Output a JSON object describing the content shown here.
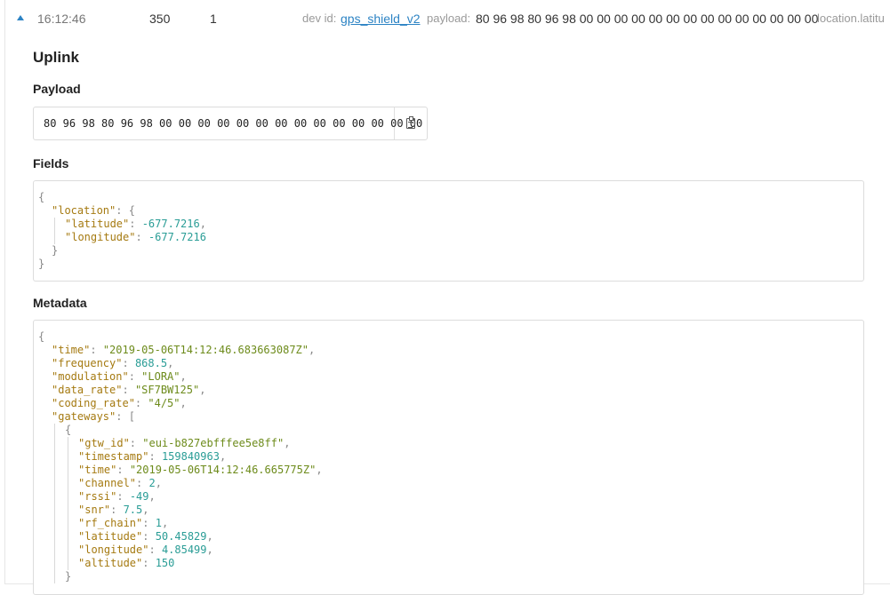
{
  "row": {
    "time": "16:12:46",
    "counter": "350",
    "port": "1",
    "dev_id_label": "dev id:",
    "dev_id": "gps_shield_v2",
    "payload_label": "payload:",
    "payload": "80 96 98 80 96 98 00 00 00 00 00 00 00 00 00 00 00 00 00 00",
    "fields_preview": "location.latitu"
  },
  "uplink": {
    "title": "Uplink",
    "payload_heading": "Payload",
    "payload_hex": "80 96 98 80 96 98 00 00 00 00 00 00 00 00 00 00 00 00 00 00",
    "fields_heading": "Fields",
    "metadata_heading": "Metadata"
  },
  "fields_lines": [
    {
      "indent": 0,
      "parts": [
        {
          "c": "p",
          "t": "{"
        }
      ]
    },
    {
      "indent": 1,
      "parts": [
        {
          "c": "k",
          "t": "\"location\""
        },
        {
          "c": "p",
          "t": ": {"
        }
      ]
    },
    {
      "indent": 2,
      "parts": [
        {
          "c": "k",
          "t": "\"latitude\""
        },
        {
          "c": "p",
          "t": ": "
        },
        {
          "c": "n",
          "t": "-677.7216"
        },
        {
          "c": "p",
          "t": ","
        }
      ]
    },
    {
      "indent": 2,
      "parts": [
        {
          "c": "k",
          "t": "\"longitude\""
        },
        {
          "c": "p",
          "t": ": "
        },
        {
          "c": "n",
          "t": "-677.7216"
        }
      ]
    },
    {
      "indent": 1,
      "parts": [
        {
          "c": "p",
          "t": "}"
        }
      ]
    },
    {
      "indent": 0,
      "parts": [
        {
          "c": "p",
          "t": "}"
        }
      ]
    }
  ],
  "metadata_lines": [
    {
      "indent": 0,
      "parts": [
        {
          "c": "p",
          "t": "{"
        }
      ]
    },
    {
      "indent": 1,
      "parts": [
        {
          "c": "k",
          "t": "\"time\""
        },
        {
          "c": "p",
          "t": ": "
        },
        {
          "c": "s",
          "t": "\"2019-05-06T14:12:46.683663087Z\""
        },
        {
          "c": "p",
          "t": ","
        }
      ]
    },
    {
      "indent": 1,
      "parts": [
        {
          "c": "k",
          "t": "\"frequency\""
        },
        {
          "c": "p",
          "t": ": "
        },
        {
          "c": "n",
          "t": "868.5"
        },
        {
          "c": "p",
          "t": ","
        }
      ]
    },
    {
      "indent": 1,
      "parts": [
        {
          "c": "k",
          "t": "\"modulation\""
        },
        {
          "c": "p",
          "t": ": "
        },
        {
          "c": "s",
          "t": "\"LORA\""
        },
        {
          "c": "p",
          "t": ","
        }
      ]
    },
    {
      "indent": 1,
      "parts": [
        {
          "c": "k",
          "t": "\"data_rate\""
        },
        {
          "c": "p",
          "t": ": "
        },
        {
          "c": "s",
          "t": "\"SF7BW125\""
        },
        {
          "c": "p",
          "t": ","
        }
      ]
    },
    {
      "indent": 1,
      "parts": [
        {
          "c": "k",
          "t": "\"coding_rate\""
        },
        {
          "c": "p",
          "t": ": "
        },
        {
          "c": "s",
          "t": "\"4/5\""
        },
        {
          "c": "p",
          "t": ","
        }
      ]
    },
    {
      "indent": 1,
      "parts": [
        {
          "c": "k",
          "t": "\"gateways\""
        },
        {
          "c": "p",
          "t": ": ["
        }
      ]
    },
    {
      "indent": 2,
      "parts": [
        {
          "c": "p",
          "t": "{"
        }
      ]
    },
    {
      "indent": 3,
      "parts": [
        {
          "c": "k",
          "t": "\"gtw_id\""
        },
        {
          "c": "p",
          "t": ": "
        },
        {
          "c": "s",
          "t": "\"eui-b827ebfffee5e8ff\""
        },
        {
          "c": "p",
          "t": ","
        }
      ]
    },
    {
      "indent": 3,
      "parts": [
        {
          "c": "k",
          "t": "\"timestamp\""
        },
        {
          "c": "p",
          "t": ": "
        },
        {
          "c": "n",
          "t": "159840963"
        },
        {
          "c": "p",
          "t": ","
        }
      ]
    },
    {
      "indent": 3,
      "parts": [
        {
          "c": "k",
          "t": "\"time\""
        },
        {
          "c": "p",
          "t": ": "
        },
        {
          "c": "s",
          "t": "\"2019-05-06T14:12:46.665775Z\""
        },
        {
          "c": "p",
          "t": ","
        }
      ]
    },
    {
      "indent": 3,
      "parts": [
        {
          "c": "k",
          "t": "\"channel\""
        },
        {
          "c": "p",
          "t": ": "
        },
        {
          "c": "n",
          "t": "2"
        },
        {
          "c": "p",
          "t": ","
        }
      ]
    },
    {
      "indent": 3,
      "parts": [
        {
          "c": "k",
          "t": "\"rssi\""
        },
        {
          "c": "p",
          "t": ": "
        },
        {
          "c": "n",
          "t": "-49"
        },
        {
          "c": "p",
          "t": ","
        }
      ]
    },
    {
      "indent": 3,
      "parts": [
        {
          "c": "k",
          "t": "\"snr\""
        },
        {
          "c": "p",
          "t": ": "
        },
        {
          "c": "n",
          "t": "7.5"
        },
        {
          "c": "p",
          "t": ","
        }
      ]
    },
    {
      "indent": 3,
      "parts": [
        {
          "c": "k",
          "t": "\"rf_chain\""
        },
        {
          "c": "p",
          "t": ": "
        },
        {
          "c": "n",
          "t": "1"
        },
        {
          "c": "p",
          "t": ","
        }
      ]
    },
    {
      "indent": 3,
      "parts": [
        {
          "c": "k",
          "t": "\"latitude\""
        },
        {
          "c": "p",
          "t": ": "
        },
        {
          "c": "n",
          "t": "50.45829"
        },
        {
          "c": "p",
          "t": ","
        }
      ]
    },
    {
      "indent": 3,
      "parts": [
        {
          "c": "k",
          "t": "\"longitude\""
        },
        {
          "c": "p",
          "t": ": "
        },
        {
          "c": "n",
          "t": "4.85499"
        },
        {
          "c": "p",
          "t": ","
        }
      ]
    },
    {
      "indent": 3,
      "parts": [
        {
          "c": "k",
          "t": "\"altitude\""
        },
        {
          "c": "p",
          "t": ": "
        },
        {
          "c": "n",
          "t": "150"
        }
      ]
    },
    {
      "indent": 2,
      "parts": [
        {
          "c": "p",
          "t": "}"
        }
      ]
    }
  ],
  "colors": {
    "link": "#2c83c4",
    "json_key": "#a57a11",
    "json_string": "#6d8b1b",
    "json_number": "#2a9d96",
    "json_punct": "#888888"
  },
  "icons": {
    "expand": "caret-up-icon",
    "copy": "clipboard-icon"
  }
}
